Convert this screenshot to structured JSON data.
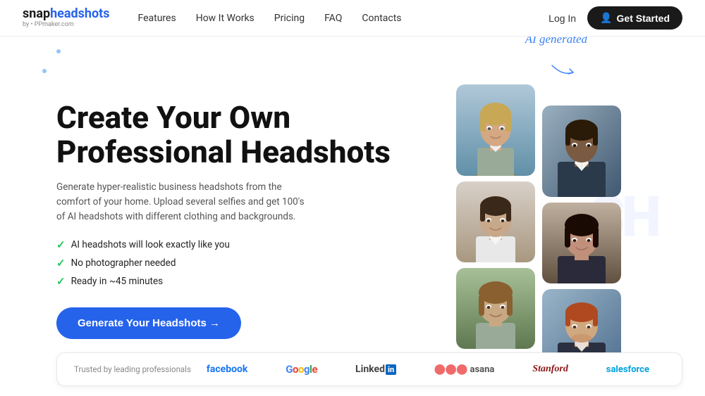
{
  "nav": {
    "logo": {
      "snap": "snap",
      "head": "headshots",
      "sub": "by • PPmaker.com"
    },
    "links": [
      {
        "label": "Features",
        "id": "features"
      },
      {
        "label": "How It Works",
        "id": "how-it-works"
      },
      {
        "label": "Pricing",
        "id": "pricing"
      },
      {
        "label": "FAQ",
        "id": "faq"
      },
      {
        "label": "Contacts",
        "id": "contacts"
      }
    ],
    "login_label": "Log In",
    "cta_label": "Get Started"
  },
  "hero": {
    "title": "Create Your Own Professional Headshots",
    "description": "Generate hyper-realistic business headshots from the comfort of your home. Upload several selfies and get 100's of AI headshots with different clothing and backgrounds.",
    "features": [
      "AI headshots will look exactly like you",
      "No photographer needed",
      "Ready in ~45 minutes"
    ],
    "cta_button": "Generate Your Headshots →",
    "ai_annotation": "AI generated"
  },
  "logos": {
    "trusted_label": "Trusted by leading professionals",
    "brands": [
      {
        "name": "facebook",
        "class": "brand-facebook"
      },
      {
        "name": "Google",
        "class": "brand-google"
      },
      {
        "name": "LinkedIn",
        "class": "brand-linkedin"
      },
      {
        "name": "asana",
        "class": "brand-asana"
      },
      {
        "name": "Stanford",
        "class": "brand-stanford"
      },
      {
        "name": "salesforce",
        "class": "brand-salesforce"
      }
    ]
  }
}
